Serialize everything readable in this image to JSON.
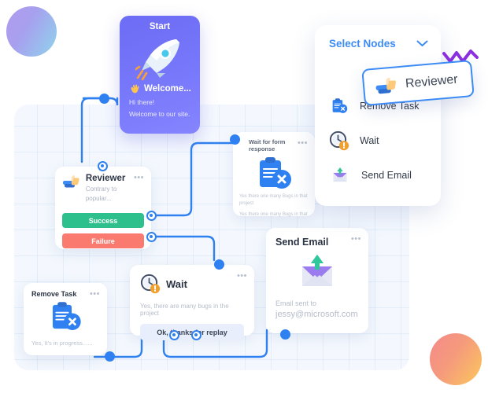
{
  "start_card": {
    "title": "Start",
    "icon": "rocket-icon",
    "wave_icon": "waving-hand-icon",
    "welcome_label": "Welcome...",
    "lines": [
      "Hi there!",
      "Welcome to our site."
    ],
    "gradient_from": "#6c6cf5",
    "gradient_to": "#8585ff"
  },
  "reviewer_node": {
    "title": "Reviewer",
    "subtitle": "Contrary to popular...",
    "icon": "thumbs-up-review-icon",
    "menu_icon": "ellipsis-icon",
    "success_label": "Success",
    "failure_label": "Failure",
    "success_color": "#2dc08d",
    "failure_color": "#fa7a70"
  },
  "form_node": {
    "title": "Wait for form response",
    "icon": "clipboard-x-icon",
    "menu_icon": "ellipsis-icon",
    "lines": [
      "Yes there one many Bugs in that project",
      "Yes there one many Bugs in that"
    ]
  },
  "wait_node": {
    "title": "Wait",
    "icon": "clock-alert-icon",
    "menu_icon": "ellipsis-icon",
    "body": "Yes, there are many bugs in the project",
    "reply_button": "Ok, thanks for replay"
  },
  "email_node": {
    "title": "Send Email",
    "icon": "send-email-icon",
    "menu_icon": "ellipsis-icon",
    "sent_label": "Email sent to",
    "address": "jessy@microsoft.com"
  },
  "remove_node": {
    "title": "Remove Task",
    "icon": "clipboard-x-icon",
    "menu_icon": "ellipsis-icon",
    "body": "Yes, It's in progress......"
  },
  "panel": {
    "title": "Select Nodes",
    "chevron_icon": "chevron-down-icon",
    "accent_color": "#3d8bf5",
    "items": [
      {
        "label": "Remove Task",
        "icon": "clipboard-x-icon"
      },
      {
        "label": "Wait",
        "icon": "clock-alert-icon"
      },
      {
        "label": "Send Email",
        "icon": "send-email-icon"
      }
    ]
  },
  "drag_chip": {
    "label": "Reviewer",
    "icon": "thumbs-up-review-icon",
    "border_color": "#3d8bf5"
  },
  "decor": {
    "squiggle_color": "#8b2fe0",
    "blob_top_left": "#a7a0ee",
    "blob_bottom_right": "#f59a7c",
    "canvas_color": "#f4f8fe",
    "wire_color": "#2f80f0"
  }
}
